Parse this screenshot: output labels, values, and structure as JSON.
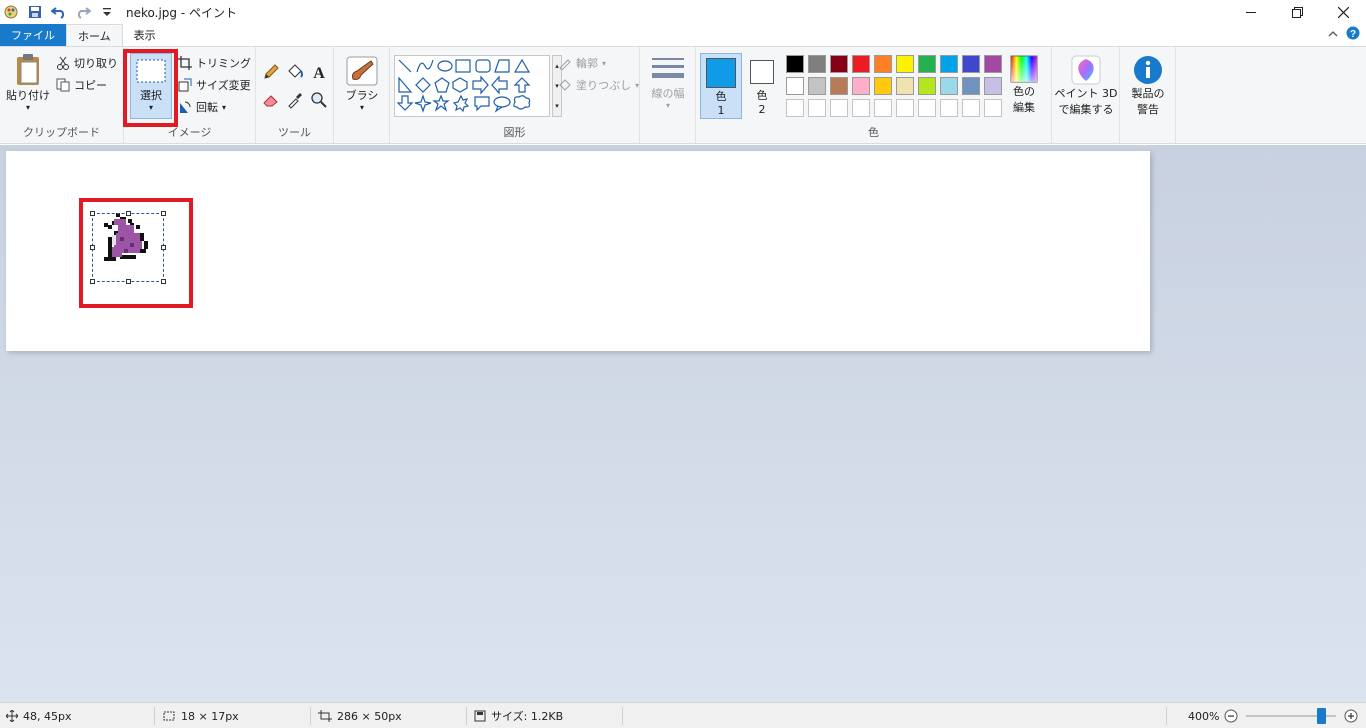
{
  "window": {
    "title": "neko.jpg - ペイント",
    "controls": [
      "minimize",
      "restore",
      "close"
    ]
  },
  "tabs": [
    {
      "label": "ファイル"
    },
    {
      "label": "ホーム"
    },
    {
      "label": "表示"
    }
  ],
  "ribbon": {
    "clipboard": {
      "label": "クリップボード",
      "paste": "貼り付け",
      "cut": "切り取り",
      "copy": "コピー"
    },
    "image": {
      "label": "イメージ",
      "select": "選択",
      "crop": "トリミング",
      "resize": "サイズ変更",
      "rotate": "回転"
    },
    "tools": {
      "label": "ツール"
    },
    "brushes": {
      "label": "ブラシ"
    },
    "shapes": {
      "label": "図形",
      "outline": "輪郭",
      "fill": "塗りつぶし"
    },
    "size": {
      "label": "線の幅"
    },
    "colors": {
      "label": "色",
      "color1_label": "色",
      "color1_num": "1",
      "color2_label": "色",
      "color2_num": "2",
      "edit_colors_line1": "色の",
      "edit_colors_line2": "編集",
      "color1_value": "#0f9be8",
      "color2_value": "#ffffff",
      "palette_row1": [
        "#000000",
        "#7f7f7f",
        "#880015",
        "#ed1c24",
        "#ff7f27",
        "#fff200",
        "#22b14c",
        "#00a2e8",
        "#3f48cc",
        "#a349a4"
      ],
      "palette_row2": [
        "#ffffff",
        "#c3c3c3",
        "#b97a57",
        "#ffaec9",
        "#ffc90e",
        "#efe4b0",
        "#b5e61d",
        "#99d9ea",
        "#7092be",
        "#c8bfe7"
      ]
    },
    "paint3d": {
      "line1": "ペイント 3D",
      "line2": "で編集する"
    },
    "product_alert": {
      "line1": "製品の",
      "line2": "警告"
    }
  },
  "status": {
    "cursor_pos": "48, 45px",
    "selection_size": "18 × 17px",
    "image_size": "286 × 50px",
    "file_size": "サイズ: 1.2KB",
    "zoom": "400%",
    "zoom_level_percent": 400
  }
}
